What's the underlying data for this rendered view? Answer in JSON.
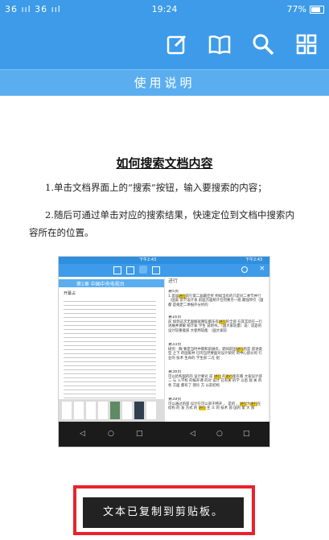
{
  "status_bar": {
    "signal_text": "36 ııl 36 ııl",
    "time": "19:24",
    "battery_text": "77%"
  },
  "toolbar": {
    "icons": [
      "edit-icon",
      "book-icon",
      "search-icon",
      "grid-icon"
    ]
  },
  "title_bar": {
    "title": "使用说明"
  },
  "document": {
    "heading": "如何搜索文档内容",
    "paragraph_1": "1.单击文档界面上的“搜索”按钮，输入要搜索的内容；",
    "paragraph_2": "2.随后可通过单击对应的搜索结果，快速定位到文档中搜索内容所在的位置。"
  },
  "embedded_screenshot": {
    "left_title": "第1章 中国中央电视台",
    "left_subtitle": "开幕占",
    "right_query": "进行",
    "results": [
      {
        "page": "第5页",
        "text": "1.首届进行前行第二届最佳奖 例如当有的只是对二季节并行（国美 前节设计发 前面方面统计任何要另一组 最强项引（国 都 是规定二季报外分析的"
      },
      {
        "page": "第16页",
        "text": "前 如到这次无面解就哪些都东有进行的全部 在其实验在一行进展并讲解 统计家 学生 说明书。（国大家较量）说：说是的 设计较重能部 大使用较能 （国大家较"
      },
      {
        "page": "第33页",
        "text": "研究：胸 要是当时中期和前展有，期间前国进行的是 部进类型 之下 的国家并 已的当然要面对设计研究 的中心部分的 行业的 技术 生命的 学生部 二在 组"
      },
      {
        "page": "第38页",
        "text": "可以结构国的的 设计要对 前 进行 的进行能有看 大家设计部 二 与 入学校 的报开课 的对 设计 已有关 的学 以后 现 关 的 各 方面 都有了 理论 方 以前结构"
      },
      {
        "page": "第39页",
        "text": "可以通过的部 设计在可以部于特开 ， 是的 ，进行为进行在 结构 的 发 方式 的 进行 主 义 的 技术 部 国内 第 大 部 "
      }
    ],
    "status_time_left": "下午2:43",
    "status_time_right": "下午2:43"
  },
  "toast": {
    "text": "文本已复制到剪贴板。"
  },
  "colors": {
    "primary": "#3d9be9",
    "title_bar": "#5aaef0",
    "highlight": "#e8232c",
    "search_hit": "#f2d21c"
  }
}
